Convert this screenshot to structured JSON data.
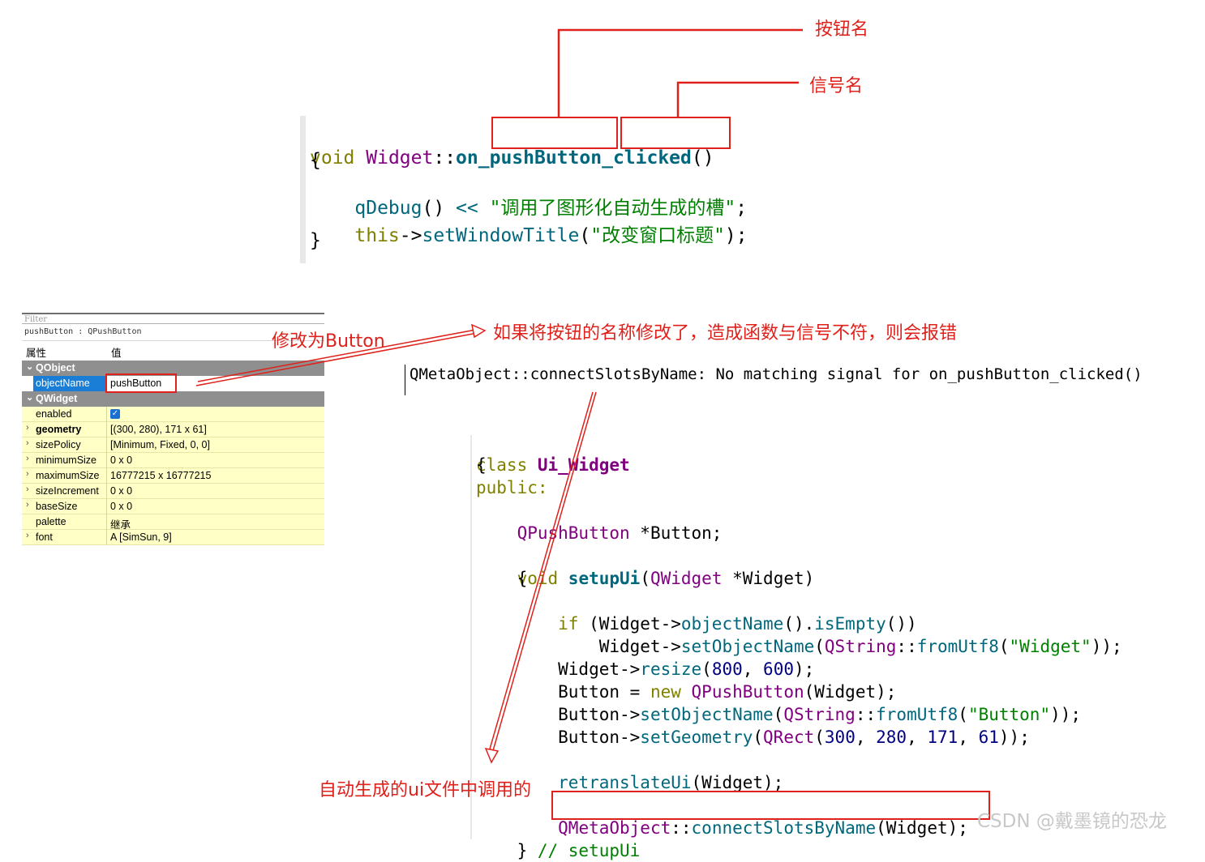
{
  "annotations": {
    "button_name": "按钮名",
    "signal_name": "信号名",
    "rename_to": "修改为Button",
    "error_note": "如果将按钮的名称修改了，造成函数与信号不符，则会报错",
    "auto_generated": "自动生成的ui文件中调用的",
    "watermark": "CSDN @戴墨镜的恐龙"
  },
  "top_code": {
    "l1_void": "void ",
    "l1_class": "Widget",
    "l1_scope": "::",
    "l1_on": "on_",
    "l1_button": "pushButton",
    "l1_us": "_",
    "l1_clicked": "clicked",
    "l1_parens": "()",
    "l2": "{",
    "l3_fn": "    qDebug",
    "l3_parens": "() ",
    "l3_op": "<<",
    "l3_str": " \"调用了图形化自动生成的槽\"",
    "l3_end": ";",
    "l4_this": "    this",
    "l4_arrow": "->",
    "l4_fn": "setWindowTitle",
    "l4_open": "(",
    "l4_str": "\"改变窗口标题\"",
    "l4_end": ");",
    "l5": "}"
  },
  "error_message": "QMetaObject::connectSlotsByName: No matching signal for on_pushButton_clicked()",
  "property_panel": {
    "filter_placeholder": "Filter",
    "object_path": "pushButton : QPushButton",
    "header_property": "属性",
    "header_value": "值",
    "rows": [
      {
        "key": "QObject",
        "value": "",
        "type": "category"
      },
      {
        "key": "objectName",
        "value": "pushButton",
        "type": "selected"
      },
      {
        "key": "QWidget",
        "value": "",
        "type": "category"
      },
      {
        "key": "enabled",
        "value": "✓",
        "type": "check"
      },
      {
        "key": "geometry",
        "value": "[(300, 280), 171 x 61]",
        "type": "bold"
      },
      {
        "key": "sizePolicy",
        "value": "[Minimum, Fixed, 0, 0]",
        "type": "normal"
      },
      {
        "key": "minimumSize",
        "value": "0 x 0",
        "type": "normal"
      },
      {
        "key": "maximumSize",
        "value": "16777215 x 16777215",
        "type": "normal"
      },
      {
        "key": "sizeIncrement",
        "value": "0 x 0",
        "type": "normal"
      },
      {
        "key": "baseSize",
        "value": "0 x 0",
        "type": "normal"
      },
      {
        "key": "palette",
        "value": "继承",
        "type": "normal"
      },
      {
        "key": "font",
        "value": "A  [SimSun, 9]",
        "type": "normal"
      }
    ]
  },
  "ui_code": {
    "l1_kw": "class ",
    "l1_name": "Ui_Widget",
    "l2": "{",
    "l3": "public:",
    "l4_type": "    QPushButton",
    "l4_rest": " *Button;",
    "l6_kw": "    void ",
    "l6_fn": "setupUi",
    "l6_open": "(",
    "l6_type": "QWidget",
    "l6_rest": " *Widget)",
    "l7": "    {",
    "l8_kw": "        if",
    "l8_a": " (Widget->",
    "l8_fn1": "objectName",
    "l8_b": "().",
    "l8_fn2": "isEmpty",
    "l8_c": "())",
    "l9_a": "            Widget->",
    "l9_fn": "setObjectName",
    "l9_b": "(",
    "l9_type": "QString",
    "l9_c": "::",
    "l9_fn2": "fromUtf8",
    "l9_d": "(",
    "l9_str": "\"Widget\"",
    "l9_e": "));",
    "l10_a": "        Widget->",
    "l10_fn": "resize",
    "l10_b": "(",
    "l10_n1": "800",
    "l10_c": ", ",
    "l10_n2": "600",
    "l10_d": ");",
    "l11_a": "        Button = ",
    "l11_kw": "new",
    "l11_sp": " ",
    "l11_type": "QPushButton",
    "l11_b": "(Widget);",
    "l12_a": "        Button->",
    "l12_fn": "setObjectName",
    "l12_b": "(",
    "l12_type": "QString",
    "l12_c": "::",
    "l12_fn2": "fromUtf8",
    "l12_d": "(",
    "l12_str": "\"Button\"",
    "l12_e": "));",
    "l13_a": "        Button->",
    "l13_fn": "setGeometry",
    "l13_b": "(",
    "l13_type": "QRect",
    "l13_c": "(",
    "l13_n1": "300",
    "l13_s1": ", ",
    "l13_n2": "280",
    "l13_s2": ", ",
    "l13_n3": "171",
    "l13_s3": ", ",
    "l13_n4": "61",
    "l13_d": "));",
    "l15_a": "        ",
    "l15_fn": "retranslateUi",
    "l15_b": "(Widget);",
    "l17_a": "        ",
    "l17_type": "QMetaObject",
    "l17_b": "::",
    "l17_fn": "connectSlotsByName",
    "l17_c": "(Widget);",
    "l18_a": "    } ",
    "l18_comment": "// setupUi"
  }
}
